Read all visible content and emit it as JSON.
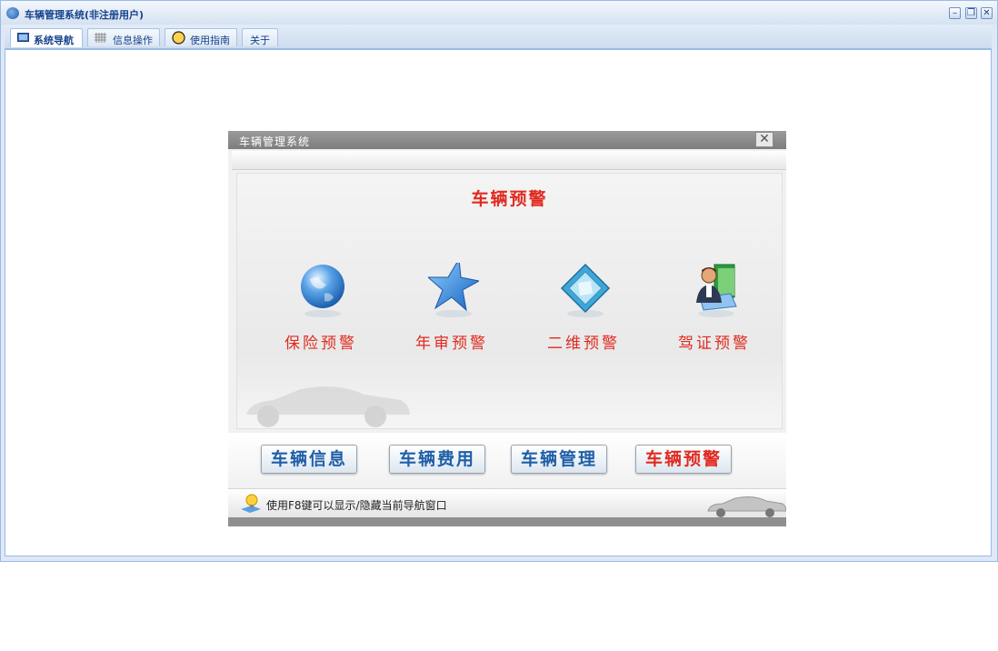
{
  "window": {
    "title": "车辆管理系统(非注册用户)",
    "buttons": {
      "minimize": "–",
      "restore": "❐",
      "close": "✕"
    }
  },
  "tabs": [
    {
      "label": "系统导航",
      "icon": "monitor-icon",
      "active": true
    },
    {
      "label": "信息操作",
      "icon": "grid-icon",
      "active": false
    },
    {
      "label": "使用指南",
      "icon": "help-icon",
      "active": false
    },
    {
      "label": "关于",
      "icon": "",
      "active": false
    }
  ],
  "dialog": {
    "title": "车辆管理系统",
    "close": "✕",
    "panel_title": "车辆预警",
    "features": [
      {
        "label": "保险预警",
        "icon": "globe-icon"
      },
      {
        "label": "年审预警",
        "icon": "star-icon"
      },
      {
        "label": "二维预警",
        "icon": "diamond-card-icon"
      },
      {
        "label": "驾证预警",
        "icon": "person-book-icon"
      }
    ],
    "buttons": [
      {
        "label": "车辆信息",
        "active": false
      },
      {
        "label": "车辆费用",
        "active": false
      },
      {
        "label": "车辆管理",
        "active": false
      },
      {
        "label": "车辆预警",
        "active": true
      }
    ],
    "status": {
      "text": "使用F8键可以显示/隐藏当前导航窗口",
      "icon": "lightbulb-icon"
    }
  },
  "colors": {
    "accent_red": "#e12a1f",
    "button_blue": "#1f5fa8",
    "title_blue": "#15428b"
  }
}
